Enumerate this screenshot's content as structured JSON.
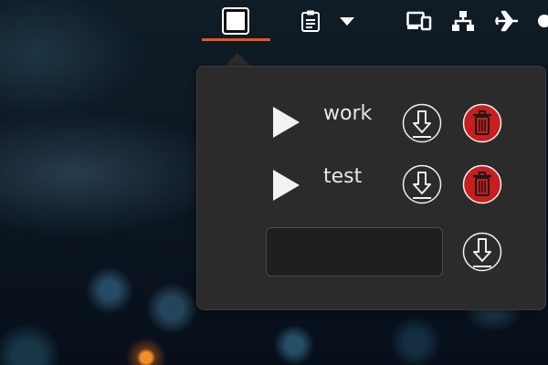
{
  "topbar": {
    "items": [
      {
        "icon": "square-app-icon",
        "active": true
      },
      {
        "icon": "clipboard-icon"
      },
      {
        "icon": "chevron-down-icon"
      },
      {
        "icon": "display-devices-icon"
      },
      {
        "icon": "network-icon"
      },
      {
        "icon": "airplane-mode-icon"
      },
      {
        "icon": "status-dot-icon"
      }
    ],
    "accent_color": "#e95420"
  },
  "popup": {
    "rows": [
      {
        "label": "work",
        "play_icon": "play-icon",
        "save_icon": "download-icon",
        "delete_icon": "trash-icon"
      },
      {
        "label": "test",
        "play_icon": "play-icon",
        "save_icon": "download-icon",
        "delete_icon": "trash-icon"
      }
    ],
    "new_entry": {
      "value": "",
      "save_icon": "download-icon"
    },
    "delete_color": "#cc1e1e"
  }
}
